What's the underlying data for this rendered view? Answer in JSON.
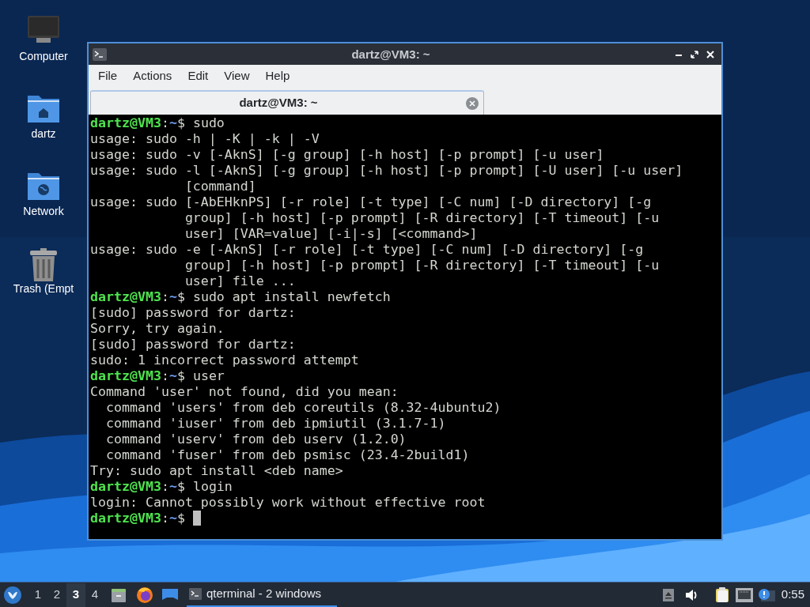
{
  "desktop_icons": [
    {
      "kind": "computer",
      "label": "Computer"
    },
    {
      "kind": "home",
      "label": "dartz"
    },
    {
      "kind": "network",
      "label": "Network"
    },
    {
      "kind": "trash",
      "label": "Trash (Empt"
    }
  ],
  "window": {
    "title": "dartz@VM3: ~",
    "menu": [
      "File",
      "Actions",
      "Edit",
      "View",
      "Help"
    ],
    "tabs": [
      {
        "label": "dartz@VM3: ~",
        "selected": true
      }
    ],
    "lines": [
      {
        "kind": "prompt",
        "user": "dartz@VM3",
        "sep": ":",
        "path": "~",
        "symbol": "$",
        "command": "sudo"
      },
      {
        "kind": "output",
        "text": "usage: sudo -h | -K | -k | -V"
      },
      {
        "kind": "output",
        "text": "usage: sudo -v [-AknS] [-g group] [-h host] [-p prompt] [-u user]"
      },
      {
        "kind": "output",
        "text": "usage: sudo -l [-AknS] [-g group] [-h host] [-p prompt] [-U user] [-u user]"
      },
      {
        "kind": "output",
        "text": "            [command]"
      },
      {
        "kind": "output",
        "text": "usage: sudo [-AbEHknPS] [-r role] [-t type] [-C num] [-D directory] [-g"
      },
      {
        "kind": "output",
        "text": "            group] [-h host] [-p prompt] [-R directory] [-T timeout] [-u"
      },
      {
        "kind": "output",
        "text": "            user] [VAR=value] [-i|-s] [<command>]"
      },
      {
        "kind": "output",
        "text": "usage: sudo -e [-AknS] [-r role] [-t type] [-C num] [-D directory] [-g"
      },
      {
        "kind": "output",
        "text": "            group] [-h host] [-p prompt] [-R directory] [-T timeout] [-u"
      },
      {
        "kind": "output",
        "text": "            user] file ..."
      },
      {
        "kind": "prompt",
        "user": "dartz@VM3",
        "sep": ":",
        "path": "~",
        "symbol": "$",
        "command": "sudo apt install newfetch"
      },
      {
        "kind": "output",
        "text": "[sudo] password for dartz:"
      },
      {
        "kind": "output",
        "text": "Sorry, try again."
      },
      {
        "kind": "output",
        "text": "[sudo] password for dartz:"
      },
      {
        "kind": "output",
        "text": "sudo: 1 incorrect password attempt"
      },
      {
        "kind": "prompt",
        "user": "dartz@VM3",
        "sep": ":",
        "path": "~",
        "symbol": "$",
        "command": "user"
      },
      {
        "kind": "output",
        "text": "Command 'user' not found, did you mean:"
      },
      {
        "kind": "output",
        "text": "  command 'users' from deb coreutils (8.32-4ubuntu2)"
      },
      {
        "kind": "output",
        "text": "  command 'iuser' from deb ipmiutil (3.1.7-1)"
      },
      {
        "kind": "output",
        "text": "  command 'userv' from deb userv (1.2.0)"
      },
      {
        "kind": "output",
        "text": "  command 'fuser' from deb psmisc (23.4-2build1)"
      },
      {
        "kind": "output",
        "text": "Try: sudo apt install <deb name>"
      },
      {
        "kind": "prompt",
        "user": "dartz@VM3",
        "sep": ":",
        "path": "~",
        "symbol": "$",
        "command": "login"
      },
      {
        "kind": "output",
        "text": "login: Cannot possibly work without effective root"
      },
      {
        "kind": "prompt",
        "user": "dartz@VM3",
        "sep": ":",
        "path": "~",
        "symbol": "$",
        "cursor": true
      }
    ]
  },
  "taskbar": {
    "workspaces": [
      {
        "label": "1",
        "selected": false
      },
      {
        "label": "2",
        "selected": false
      },
      {
        "label": "3",
        "selected": true
      },
      {
        "label": "4",
        "selected": false
      }
    ],
    "task": "qterminal - 2 windows",
    "clock": "0:55"
  }
}
